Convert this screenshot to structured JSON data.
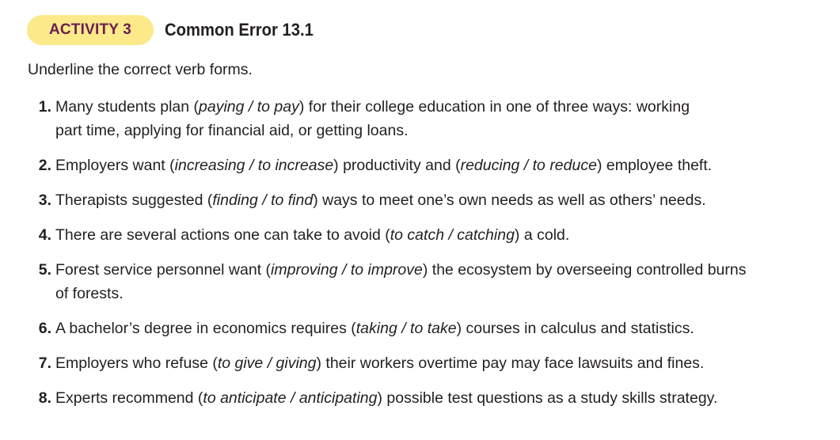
{
  "header": {
    "badge_label": "ACTIVITY 3",
    "title": "Common Error 13.1"
  },
  "instructions": "Underline the correct verb forms.",
  "items": [
    {
      "number": "1.",
      "parts": [
        {
          "t": "Many students plan (",
          "i": false
        },
        {
          "t": "paying / to pay",
          "i": true
        },
        {
          "t": ") for their college education in one of three ways: working",
          "i": false
        },
        {
          "br": true
        },
        {
          "t": "part time, applying for financial aid, or getting loans.",
          "i": false
        }
      ]
    },
    {
      "number": "2.",
      "parts": [
        {
          "t": "Employers want (",
          "i": false
        },
        {
          "t": "increasing / to increase",
          "i": true
        },
        {
          "t": ") productivity and (",
          "i": false
        },
        {
          "t": "reducing / to reduce",
          "i": true
        },
        {
          "t": ") employee theft.",
          "i": false
        }
      ]
    },
    {
      "number": "3.",
      "parts": [
        {
          "t": "Therapists suggested (",
          "i": false
        },
        {
          "t": "finding / to find",
          "i": true
        },
        {
          "t": ") ways to meet one’s own needs as well as others’ needs.",
          "i": false
        }
      ]
    },
    {
      "number": "4.",
      "parts": [
        {
          "t": "There are several actions one can take to avoid (",
          "i": false
        },
        {
          "t": "to catch / catching",
          "i": true
        },
        {
          "t": ") a cold.",
          "i": false
        }
      ]
    },
    {
      "number": "5.",
      "parts": [
        {
          "t": "Forest service personnel want (",
          "i": false
        },
        {
          "t": "improving / to improve",
          "i": true
        },
        {
          "t": ") the ecosystem by overseeing controlled burns",
          "i": false
        },
        {
          "br": true
        },
        {
          "t": "of forests.",
          "i": false
        }
      ]
    },
    {
      "number": "6.",
      "parts": [
        {
          "t": "A bachelor’s degree in economics requires (",
          "i": false
        },
        {
          "t": "taking / to take",
          "i": true
        },
        {
          "t": ") courses in calculus and statistics.",
          "i": false
        }
      ]
    },
    {
      "number": "7.",
      "parts": [
        {
          "t": "Employers who refuse (",
          "i": false
        },
        {
          "t": "to give / giving",
          "i": true
        },
        {
          "t": ") their workers overtime pay may face lawsuits and fines.",
          "i": false
        }
      ]
    },
    {
      "number": "8.",
      "parts": [
        {
          "t": "Experts recommend (",
          "i": false
        },
        {
          "t": "to anticipate / anticipating",
          "i": true
        },
        {
          "t": ") possible test questions as a study skills strategy.",
          "i": false
        }
      ]
    }
  ],
  "colors": {
    "badge_background": "#fbe98a",
    "badge_text": "#6b1f4f",
    "body_text": "#231f20"
  }
}
